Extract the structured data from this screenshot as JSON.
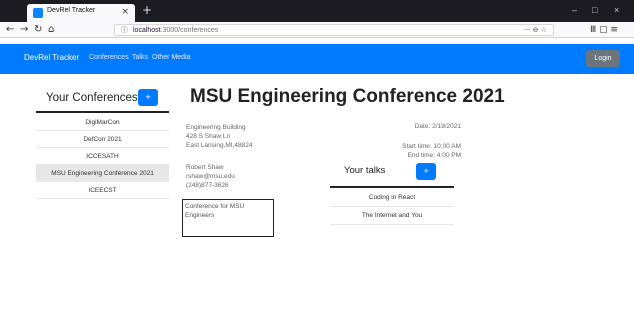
{
  "browser": {
    "tab_title": "DevRel Tracker",
    "tab_close": "×",
    "new_tab": "+",
    "window_controls": {
      "minimize": "–",
      "maximize": "□",
      "close": "×"
    },
    "nav": {
      "back": "←",
      "forward": "→",
      "reload": "↻",
      "home": "⌂"
    },
    "url": {
      "host": "localhost",
      "path": ":3000/conferences",
      "info_icon": "ⓘ"
    },
    "url_actions": "··· ⊖ ☆",
    "library_icons": "Ⅲ ▢ ≡"
  },
  "app": {
    "brand": "DevRel Tracker",
    "nav_links": [
      "Conferences",
      "Talks",
      "Other Media"
    ],
    "login_label": "Login",
    "accent": "#007bff"
  },
  "sidebar": {
    "title": "Your Conferences",
    "add_label": "+",
    "items": [
      {
        "label": "DigiMarCon"
      },
      {
        "label": "DefCon 2021"
      },
      {
        "label": "ICCESATH"
      },
      {
        "label": "MSU Engineering Conference 2021",
        "selected": true
      },
      {
        "label": "ICEECST"
      }
    ]
  },
  "conference": {
    "title": "MSU Engineering Conference 2021",
    "address": [
      "Engineering Building",
      "428 S Shaw Ln",
      "East Lansing,MI,48824"
    ],
    "date": "Date: 2/19/2021",
    "start_time": "Start time: 10:00 AM",
    "end_time": "End time: 4:00 PM",
    "contact": [
      "Robert Shaw",
      "rshaw@msu.edu",
      "(248)877-3626"
    ],
    "description": "Conference for MSU Engineers"
  },
  "talks": {
    "title": "Your talks",
    "add_label": "+",
    "items": [
      "Coding in React",
      "The Internet and You"
    ]
  }
}
